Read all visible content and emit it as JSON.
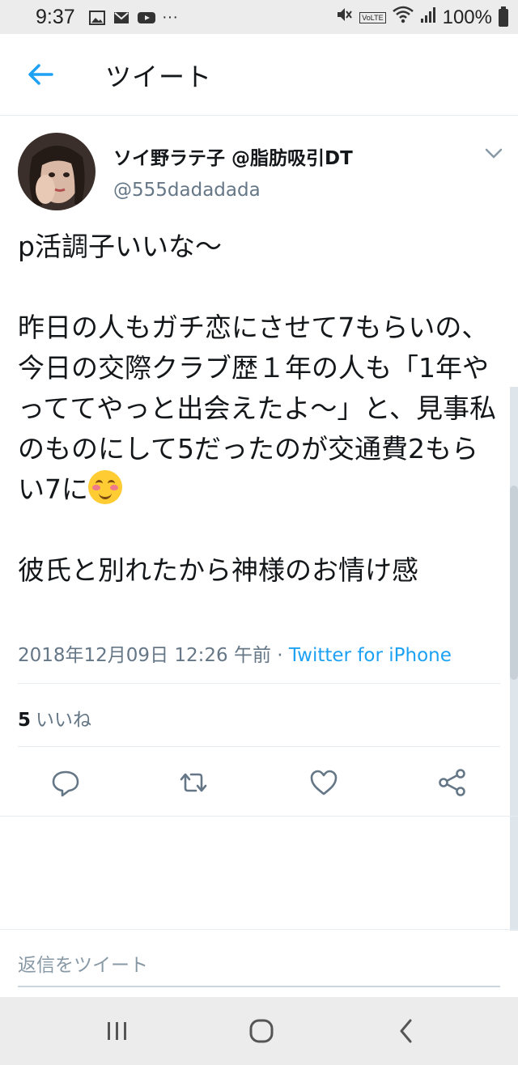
{
  "status_bar": {
    "time": "9:37",
    "battery": "100%",
    "left_icons": [
      "image-icon",
      "mail-icon",
      "youtube-icon",
      "more-icon"
    ],
    "right_icons": [
      "mute-icon",
      "volte-icon",
      "wifi-icon",
      "signal-icon",
      "battery-icon"
    ],
    "more": "···",
    "volte": "VoLTE"
  },
  "header": {
    "title": "ツイート",
    "back_icon": "arrow-left-icon"
  },
  "tweet": {
    "author_name": "ソイ野ラテ子 @脂肪吸引DT",
    "handle": "@555dadadada",
    "text_paragraph_1": "p活調子いいな〜",
    "text_paragraph_2": "昨日の人もガチ恋にさせて7もらいの、\n今日の交際クラブ歴１年の人も「1年やっててやっと出会えたよ〜」と、見事私のものにして5だったのが交通費2もらい7に",
    "emoji_icon": "smiling-blushing-face-icon",
    "text_paragraph_3": "彼氏と別れたから神様のお情け感",
    "timestamp": "2018年12月09日 12:26 午前",
    "meta_separator": " · ",
    "source": "Twitter for iPhone",
    "likes_count": "5",
    "likes_label": "いいね"
  },
  "actions": [
    "reply-icon",
    "retweet-icon",
    "like-icon",
    "share-icon"
  ],
  "reply_box": {
    "placeholder": "返信をツイート"
  },
  "nav_bar": [
    "recent-apps-icon",
    "home-icon",
    "back-icon"
  ],
  "colors": {
    "accent": "#1da1f2",
    "text": "#14171a",
    "secondary": "#657786",
    "divider": "#e6ecf0"
  }
}
